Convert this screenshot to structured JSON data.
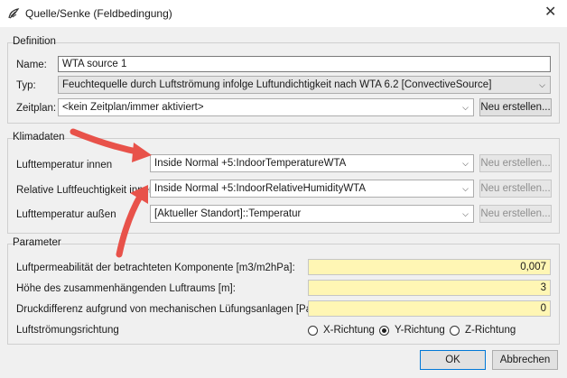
{
  "window": {
    "title": "Quelle/Senke (Feldbedingung)",
    "close_glyph": "✕"
  },
  "definition": {
    "group_title": "Definition",
    "name_label": "Name:",
    "name_value": "WTA source 1",
    "typ_label": "Typ:",
    "typ_value": "Feuchtequelle durch Luftströmung infolge Luftundichtigkeit nach WTA 6.2 [ConvectiveSource]",
    "zeitplan_label": "Zeitplan:",
    "zeitplan_value": "<kein Zeitplan/immer aktiviert>",
    "new_button": "Neu erstellen..."
  },
  "klimadaten": {
    "group_title": "Klimadaten",
    "rows": [
      {
        "label": "Lufttemperatur innen",
        "value": "Inside Normal +5:IndoorTemperatureWTA",
        "button": "Neu erstellen..."
      },
      {
        "label": "Relative Luftfeuchtigkeit innen",
        "value": "Inside Normal +5:IndoorRelativeHumidityWTA",
        "button": "Neu erstellen..."
      },
      {
        "label": "Lufttemperatur außen",
        "value": "[Aktueller Standort]::Temperatur",
        "button": "Neu erstellen..."
      }
    ]
  },
  "parameter": {
    "group_title": "Parameter",
    "rows": [
      {
        "label": "Luftpermeabilität der betrachteten Komponente [m3/m2hPa]:",
        "value": "0,007"
      },
      {
        "label": "Höhe des zusammenhängenden Luftraums [m]:",
        "value": "3"
      },
      {
        "label": "Druckdifferenz aufgrund von mechanischen Lüfungsanlagen [Pa]:",
        "value": "0"
      }
    ],
    "direction_label": "Luftströmungsrichtung",
    "directions": [
      "X-Richtung",
      "Y-Richtung",
      "Z-Richtung"
    ],
    "selected_direction": "Y-Richtung"
  },
  "footer": {
    "ok": "OK",
    "cancel": "Abbrechen"
  },
  "colors": {
    "annotation_arrow": "#e8524a",
    "numeric_field_bg": "#fff6b4",
    "default_button_border": "#0078d7"
  },
  "icons": {
    "app": "leaf-icon",
    "close": "close-icon",
    "dropdown": "chevron-down-icon"
  }
}
